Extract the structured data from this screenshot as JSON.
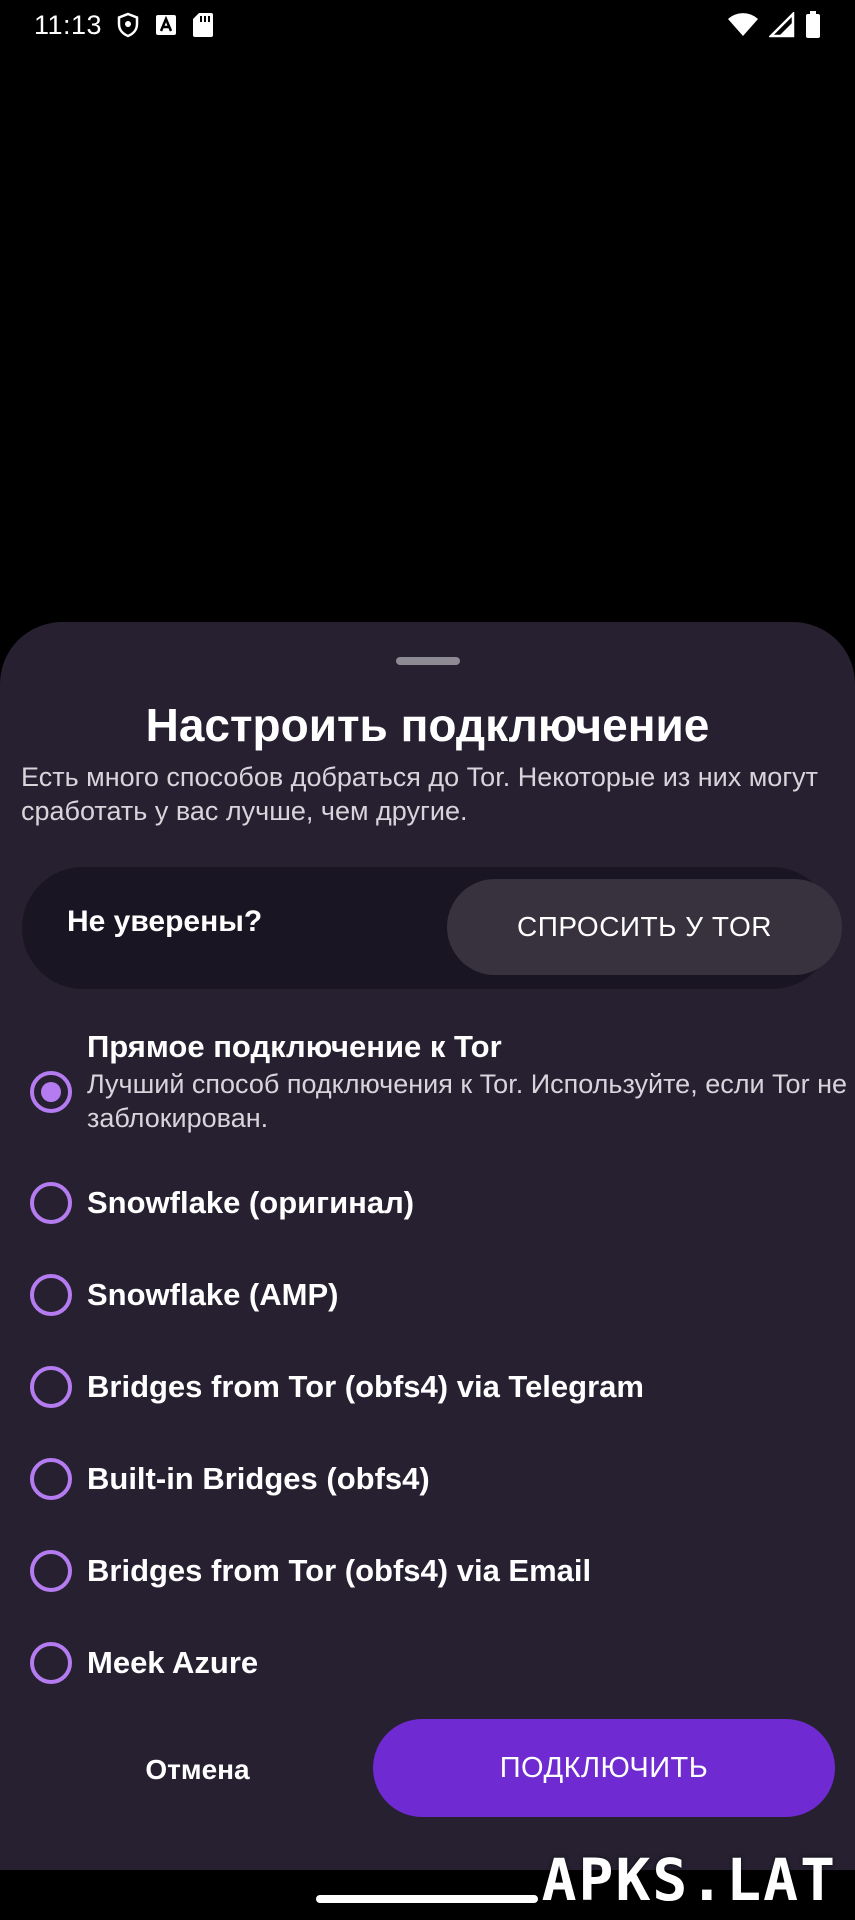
{
  "status_bar": {
    "time": "11:13",
    "icons": [
      "shield-icon",
      "font-icon",
      "sd-card-icon",
      "wifi-icon",
      "signal-icon",
      "battery-icon"
    ]
  },
  "sheet": {
    "title": "Настроить подключение",
    "subtitle": "Есть много способов добраться до Tor. Некоторые из них могут сработать у вас лучше, чем другие.",
    "ask": {
      "label": "Не уверены?",
      "button": "СПРОСИТЬ У TOR"
    },
    "options": [
      {
        "title": "Прямое подключение к Tor",
        "description": "Лучший способ подключения к Tor. Используйте, если Tor не заблокирован.",
        "selected": true
      },
      {
        "title": "Snowflake (оригинал)",
        "selected": false
      },
      {
        "title": "Snowflake (AMP)",
        "selected": false
      },
      {
        "title": "Bridges from Tor (obfs4) via Telegram",
        "selected": false
      },
      {
        "title": "Built-in Bridges (obfs4)",
        "selected": false
      },
      {
        "title": "Bridges from Tor (obfs4) via Email",
        "selected": false
      },
      {
        "title": "Meek Azure",
        "selected": false
      }
    ],
    "cancel_label": "Отмена",
    "connect_label": "ПОДКЛЮЧИТЬ"
  },
  "watermark": "APKS.LAT",
  "colors": {
    "sheet_background": "#262030",
    "accent_radio": "#b47cf0",
    "connect_button": "#6f2bd1",
    "ask_pill": "#1a1522",
    "ask_button": "#38323f"
  }
}
